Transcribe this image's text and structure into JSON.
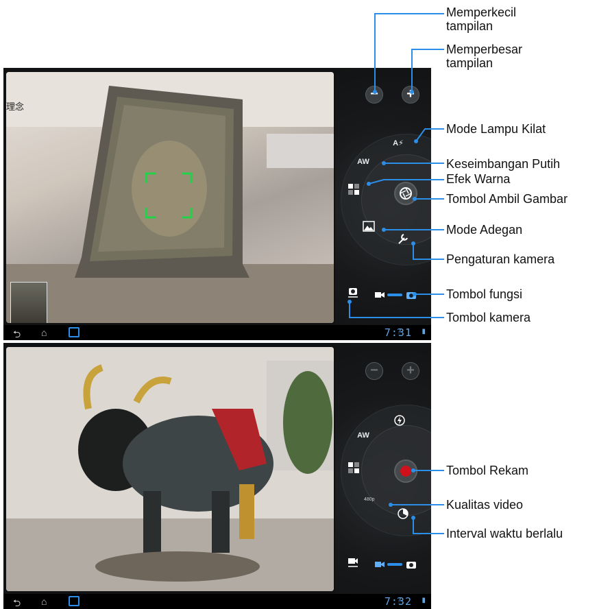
{
  "top": {
    "clock": "7:31",
    "labels": {
      "zoom_out": "Memperkecil\ntampilan",
      "zoom_in": "Memperbesar\ntampilan",
      "flash": "Mode Lampu Kilat",
      "white_balance": "Keseimbangan Putih",
      "color_effect": "Efek Warna",
      "shutter": "Tombol Ambil Gambar",
      "scene": "Mode Adegan",
      "settings": "Pengaturan kamera",
      "function": "Tombol fungsi",
      "camera": "Tombol kamera"
    },
    "icons": {
      "zoom_out": "minus-icon",
      "zoom_in": "plus-icon",
      "flash": "flash-auto-icon",
      "white_balance": "white-balance-auto-icon",
      "color_effect": "color-effect-icon",
      "shutter": "aperture-icon",
      "scene": "scene-landscape-icon",
      "settings": "wrench-icon",
      "camera_switch": "camera-switch-icon",
      "video_mode": "video-camera-icon",
      "photo_mode": "photo-camera-icon"
    },
    "glyphs": {
      "minus": "−",
      "plus": "+",
      "flash": "A⚡",
      "wb": "AW"
    }
  },
  "bottom": {
    "clock": "7:32",
    "labels": {
      "record": "Tombol Rekam",
      "video_quality": "Kualitas video",
      "time_lapse": "Interval waktu berlalu"
    },
    "video_quality_value": "480p",
    "glyphs": {
      "minus": "−",
      "plus": "+",
      "wb": "AW"
    }
  },
  "accent_color": "#2b8ee8",
  "record_color": "#d0101a"
}
